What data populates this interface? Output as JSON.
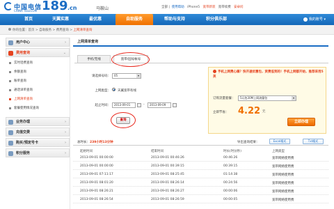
{
  "brand": {
    "name_cn": "中国电信",
    "name_en": "CHINA TELECOM",
    "site": "189",
    "tld": ".cn",
    "city": "马鞍山"
  },
  "toplinks": {
    "items": [
      "全部",
      "使用帮助",
      "iPhone5",
      "宽带新装",
      "宽带续费",
      "安卓问"
    ]
  },
  "nav": {
    "items": [
      "首页",
      "天翼实惠",
      "最优惠",
      "自助服务",
      "帮助与支持",
      "积分俱乐部"
    ],
    "account": "我的账号"
  },
  "breadcrumb": {
    "prefix": "你的位置：首页 > 自助服务 > 费用查询 > ",
    "current": "上网清单查询"
  },
  "sidebar": {
    "groups": [
      {
        "label": "用户中心"
      },
      {
        "label": "费用查询"
      }
    ],
    "sub_items": [
      "实时话费查询",
      "余额查询",
      "账单查询",
      "通话详单查询",
      "上网清单查询",
      "套餐使用情况查询"
    ],
    "more_groups": [
      "业务办理",
      "充值交费",
      "购买/预定号卡",
      "积分服务"
    ]
  },
  "main": {
    "title": "上网清单查询",
    "tabs": [
      "手机/无线",
      "宽带/固号帐号"
    ],
    "form": {
      "account_label": "请选择号码：",
      "account_value": "05",
      "type_label": "上网类型：",
      "type_option": "天翼宽带有线",
      "time_label": "起止时间：",
      "start_date": "2013-09-01",
      "end_date": "2013-09-09",
      "dash": "-",
      "query_btn": "查询"
    },
    "promo": {
      "note": "手机上网费心痛？快开通优惠包，资费低到的！手机上网都开始，推荐采用5英",
      "package_label": "订购流量套餐：",
      "package_value": "5元包30M上网流量包",
      "save_label": "立即节省：",
      "price": "4.22",
      "price_unit": "元",
      "buy_btn": "立即办理"
    },
    "result": {
      "total_prefix": "总时长：",
      "total_value": "239小时13分钟",
      "export_label": "导出查询结果：",
      "excel_btn": "Excel格式",
      "txt_btn": "Txt格式"
    },
    "table": {
      "headers": [
        "起始时间",
        "结束时间",
        "时长(时分秒)",
        "上网类型"
      ],
      "rows": [
        [
          "2013-09-01 00:00:00",
          "2013-09-01 00:46:26",
          "00:46:26",
          "宽带网络使用费"
        ],
        [
          "2013-09-01 00:00:00",
          "2013-09-01 00:39:15",
          "00:39:15",
          "宽带网络使用费"
        ],
        [
          "2013-09-01 07:11:17",
          "2013-09-01 08:25:45",
          "01:14:38",
          "宽带网络使用费"
        ],
        [
          "2013-09-01 08:01:20",
          "2013-09-01 08:26:14",
          "00:24:56",
          "宽带网络使用费"
        ],
        [
          "2013-09-01 08:26:21",
          "2013-09-01 08:26:27",
          "00:00:06",
          "宽带网络使用费"
        ],
        [
          "2013-09-01 08:26:54",
          "2013-09-01 08:26:59",
          "00:00:05",
          "宽带网络使用费"
        ]
      ]
    }
  },
  "colors": {
    "accent_blue": "#1a6cc4",
    "accent_orange": "#f07000",
    "alert_red": "#e5421f"
  }
}
